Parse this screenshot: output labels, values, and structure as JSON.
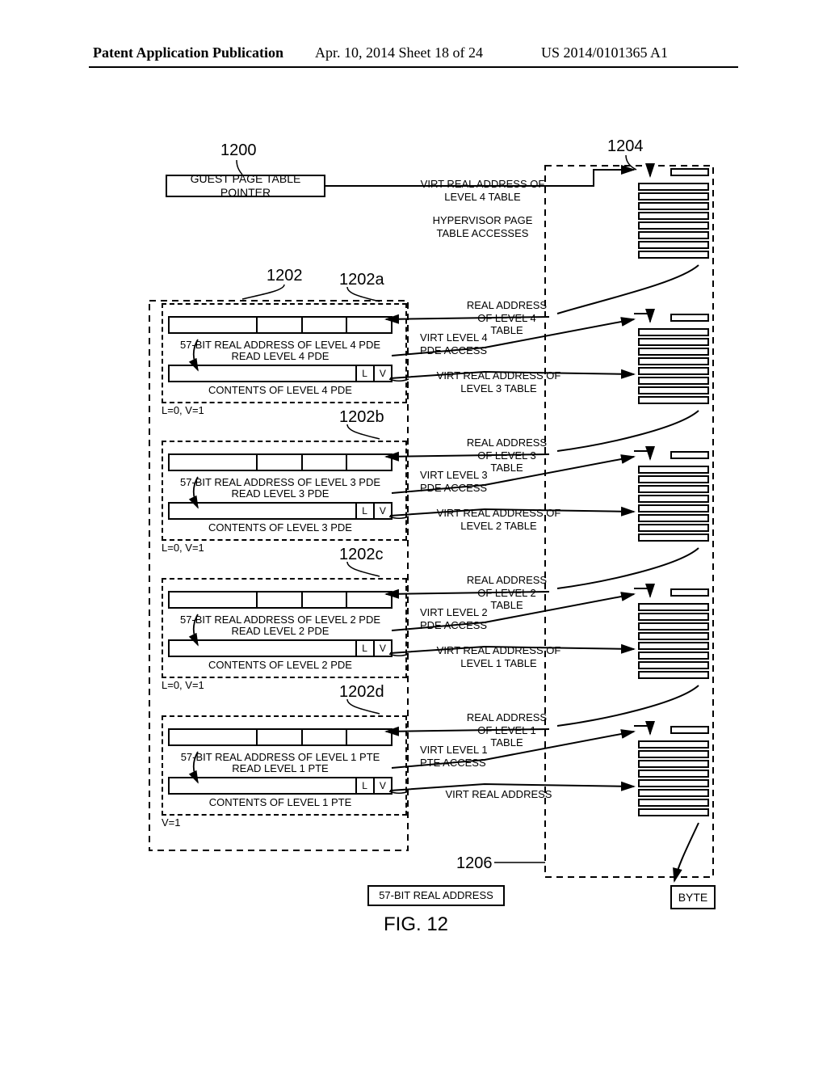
{
  "header": {
    "left": "Patent Application Publication",
    "center": "Apr. 10, 2014  Sheet 18 of 24",
    "right": "US 2014/0101365 A1"
  },
  "labels": {
    "n1200": "1200",
    "n1202": "1202",
    "n1202a": "1202a",
    "n1202b": "1202b",
    "n1202c": "1202c",
    "n1202d": "1202d",
    "n1204": "1204",
    "n1206": "1206"
  },
  "guest_ptr": "GUEST PAGE TABLE POINTER",
  "top_rt1": "VIRT REAL ADDRESS OF LEVEL 4 TABLE",
  "top_rt2": "HYPERVISOR PAGE TABLE ACCESSES",
  "block4": {
    "read": "57-BIT REAL ADDRESS OF LEVEL 4 PDE",
    "readsub": "READ LEVEL 4 PDE",
    "contents": "CONTENTS OF LEVEL 4 PDE",
    "lv": "L=0, V=1",
    "real_in": "REAL ADDRESS OF LEVEL 4 TABLE",
    "access": "VIRT LEVEL 4 PDE ACCESS",
    "real_out": "VIRT REAL ADDRESS OF LEVEL 3 TABLE"
  },
  "block3": {
    "read": "57-BIT REAL ADDRESS OF LEVEL 3 PDE",
    "readsub": "READ LEVEL 3 PDE",
    "contents": "CONTENTS OF LEVEL 3 PDE",
    "lv": "L=0, V=1",
    "real_in": "REAL ADDRESS OF LEVEL 3 TABLE",
    "access": "VIRT LEVEL 3 PDE ACCESS",
    "real_out": "VIRT REAL ADDRESS OF LEVEL 2 TABLE"
  },
  "block2": {
    "read": "57-BIT REAL ADDRESS OF LEVEL 2 PDE",
    "readsub": "READ LEVEL 2 PDE",
    "contents": "CONTENTS OF LEVEL 2 PDE",
    "lv": "L=0, V=1",
    "real_in": "REAL ADDRESS OF LEVEL 2 TABLE",
    "access": "VIRT LEVEL 2 PDE ACCESS",
    "real_out": "VIRT REAL ADDRESS OF LEVEL 1 TABLE"
  },
  "block1": {
    "read": "57-BIT REAL ADDRESS OF LEVEL 1 PTE",
    "readsub": "READ LEVEL 1 PTE",
    "contents": "CONTENTS OF LEVEL 1 PTE",
    "lv": "V=1",
    "real_in": "REAL ADDRESS OF LEVEL 1 TABLE",
    "access": "VIRT LEVEL 1 PTE ACCESS",
    "real_out": "VIRT REAL ADDRESS"
  },
  "flags": {
    "L": "L",
    "V": "V"
  },
  "bottom_left": "57-BIT REAL ADDRESS",
  "byte": "BYTE",
  "fig": "FIG. 12"
}
